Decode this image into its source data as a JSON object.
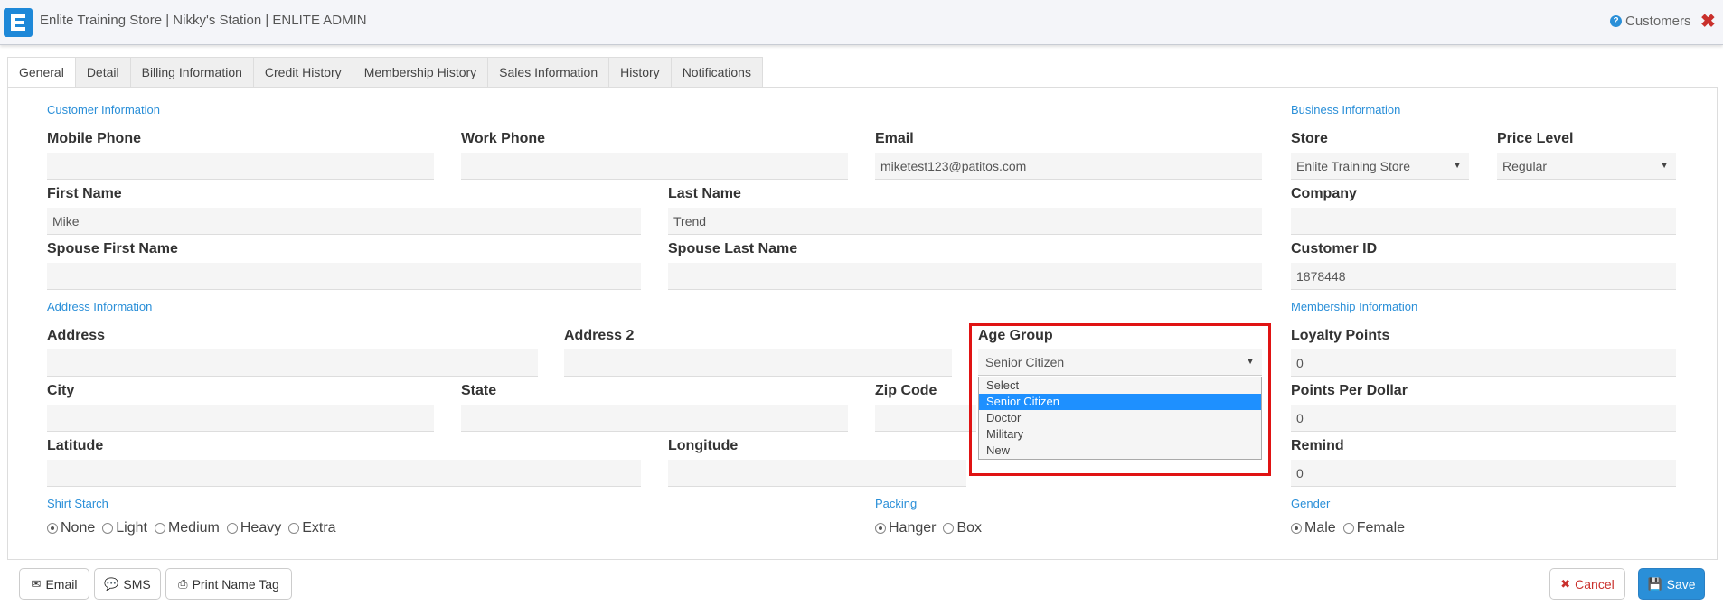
{
  "header": {
    "title": "Enlite Training Store | Nikky's Station | ENLITE ADMIN",
    "module": "Customers",
    "help_symbol": "?",
    "close_symbol": "✖"
  },
  "tabs": [
    {
      "label": "General"
    },
    {
      "label": "Detail"
    },
    {
      "label": "Billing Information"
    },
    {
      "label": "Credit History"
    },
    {
      "label": "Membership History"
    },
    {
      "label": "Sales Information"
    },
    {
      "label": "History"
    },
    {
      "label": "Notifications"
    }
  ],
  "sections": {
    "customer": "Customer Information",
    "address": "Address Information",
    "shirt": "Shirt Starch",
    "packing": "Packing",
    "business": "Business Information",
    "membership": "Membership Information",
    "gender": "Gender"
  },
  "fields": {
    "mobile_phone": {
      "label": "Mobile Phone",
      "value": ""
    },
    "work_phone": {
      "label": "Work Phone",
      "value": ""
    },
    "email": {
      "label": "Email",
      "value": "miketest123@patitos.com"
    },
    "first_name": {
      "label": "First Name",
      "value": "Mike"
    },
    "last_name": {
      "label": "Last Name",
      "value": "Trend"
    },
    "spouse_first": {
      "label": "Spouse First Name",
      "value": ""
    },
    "spouse_last": {
      "label": "Spouse Last Name",
      "value": ""
    },
    "address": {
      "label": "Address",
      "value": ""
    },
    "address2": {
      "label": "Address 2",
      "value": ""
    },
    "city": {
      "label": "City",
      "value": ""
    },
    "state": {
      "label": "State",
      "value": ""
    },
    "zip": {
      "label": "Zip Code",
      "value": ""
    },
    "latitude": {
      "label": "Latitude",
      "value": ""
    },
    "longitude": {
      "label": "Longitude",
      "value": ""
    },
    "store": {
      "label": "Store",
      "value": "Enlite Training Store"
    },
    "price_level": {
      "label": "Price Level",
      "value": "Regular"
    },
    "company": {
      "label": "Company",
      "value": ""
    },
    "customer_id": {
      "label": "Customer ID",
      "value": "1878448"
    },
    "loyalty_points": {
      "label": "Loyalty Points",
      "value": "0"
    },
    "points_per_dollar": {
      "label": "Points Per Dollar",
      "value": "0"
    },
    "remind": {
      "label": "Remind",
      "value": "0"
    }
  },
  "age_group": {
    "label": "Age Group",
    "value": "Senior Citizen",
    "options": [
      "Select",
      "Senior Citizen",
      "Doctor",
      "Military",
      "New"
    ]
  },
  "shirt_starch": {
    "options": [
      "None",
      "Light",
      "Medium",
      "Heavy",
      "Extra"
    ],
    "selected": "None"
  },
  "packing": {
    "options": [
      "Hanger",
      "Box"
    ],
    "selected": "Hanger"
  },
  "gender": {
    "options": [
      "Male",
      "Female"
    ],
    "selected": "Male"
  },
  "footer": {
    "email": "Email",
    "sms": "SMS",
    "print": "Print Name Tag",
    "cancel": "Cancel",
    "save": "Save"
  },
  "colors": {
    "accent": "#2a8fd8",
    "highlight": "#e01313",
    "danger": "#c9302c"
  }
}
